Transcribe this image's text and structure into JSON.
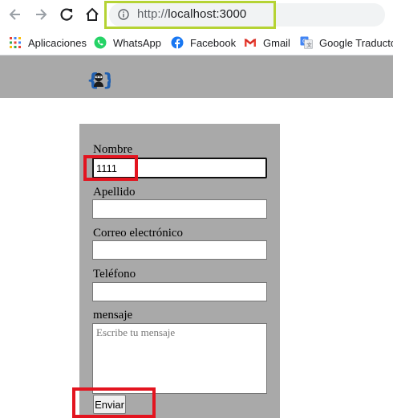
{
  "browser": {
    "url_prefix": "http://",
    "url_host": "localhost:3000"
  },
  "bookmarks": [
    {
      "label": "Aplicaciones",
      "icon": "apps-grid-icon"
    },
    {
      "label": "WhatsApp",
      "icon": "whatsapp-icon"
    },
    {
      "label": "Facebook",
      "icon": "facebook-icon"
    },
    {
      "label": "Gmail",
      "icon": "gmail-icon"
    },
    {
      "label": "Google Traductor",
      "icon": "google-translate-icon"
    }
  ],
  "site": {
    "logo_icon": "ninja-braces-logo-icon"
  },
  "form": {
    "nombre_label": "Nombre",
    "nombre_value": "1111",
    "apellido_label": "Apellido",
    "apellido_value": "",
    "correo_label": "Correo electrónico",
    "correo_value": "",
    "telefono_label": "Teléfono",
    "telefono_value": "",
    "mensaje_label": "mensaje",
    "mensaje_placeholder": "Escribe tu mensaje",
    "submit_label": "Enviar"
  },
  "colors": {
    "highlight_green": "#b5d334",
    "highlight_red": "#e3141f",
    "panel_gray": "#a9a9a9"
  }
}
